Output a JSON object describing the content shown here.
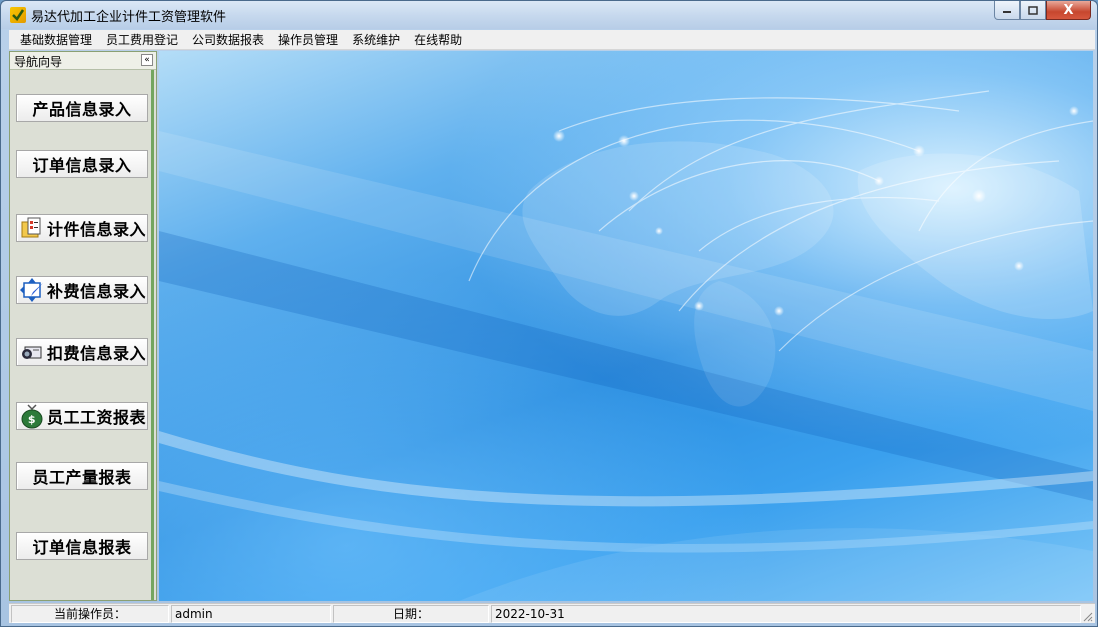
{
  "window": {
    "title": "易达代加工企业计件工资管理软件",
    "minimize_icon": "minimize-icon",
    "maximize_icon": "maximize-icon",
    "close_label": "X"
  },
  "menubar": {
    "items": [
      "基础数据管理",
      "员工费用登记",
      "公司数据报表",
      "操作员管理",
      "系统维护",
      "在线帮助"
    ]
  },
  "nav": {
    "title": "导航向导",
    "collapse_label": "«",
    "buttons": [
      {
        "label": "产品信息录入"
      },
      {
        "label": "订单信息录入"
      },
      {
        "label": "计件信息录入",
        "icon": "folder-form-icon"
      },
      {
        "label": "补费信息录入",
        "icon": "resize-arrows-icon"
      },
      {
        "label": "扣费信息录入",
        "icon": "card-icon"
      },
      {
        "label": "员工工资报表",
        "icon": "money-bag-icon"
      },
      {
        "label": "员工产量报表"
      },
      {
        "label": "订单信息报表"
      }
    ]
  },
  "statusbar": {
    "operator_label": "当前操作员：",
    "operator_value": "admin",
    "date_label": "日期：",
    "date_value": "2022-10-31"
  },
  "colors": {
    "nav_bg": "#dcdfd5",
    "nav_border": "#74a560",
    "main_blue": "#2a8de0"
  }
}
